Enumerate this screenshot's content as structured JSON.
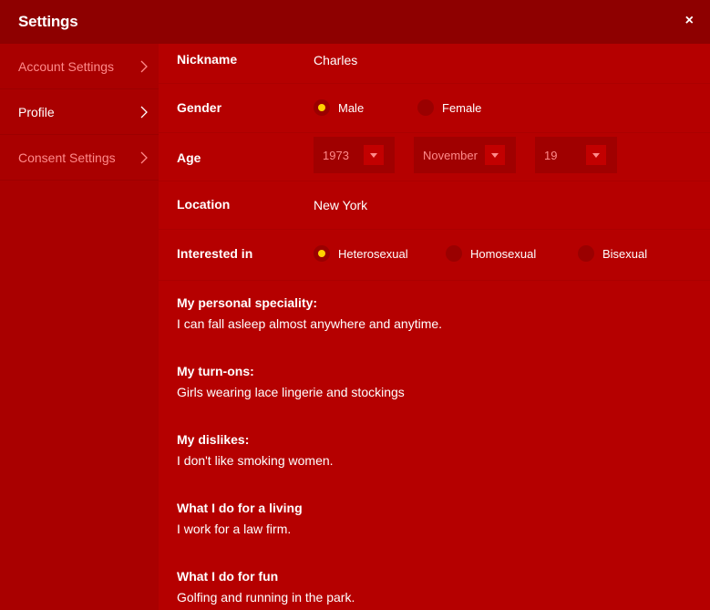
{
  "header": {
    "title": "Settings",
    "close": "×"
  },
  "sidebar": {
    "items": [
      {
        "label": "Account Settings"
      },
      {
        "label": "Profile"
      },
      {
        "label": "Consent Settings"
      }
    ]
  },
  "profile": {
    "nickname": {
      "label": "Nickname",
      "value": "Charles"
    },
    "gender": {
      "label": "Gender",
      "options": [
        "Male",
        "Female"
      ],
      "selected": "Male"
    },
    "age": {
      "label": "Age",
      "year": "1973",
      "month": "November",
      "day": "19"
    },
    "location": {
      "label": "Location",
      "value": "New York"
    },
    "interested_in": {
      "label": "Interested in",
      "options": [
        "Heterosexual",
        "Homosexual",
        "Bisexual"
      ],
      "selected": "Heterosexual"
    },
    "sections": [
      {
        "q": "My personal speciality:",
        "a": "I can fall asleep almost anywhere and anytime."
      },
      {
        "q": "My turn-ons:",
        "a": "Girls wearing lace lingerie and stockings"
      },
      {
        "q": "My dislikes:",
        "a": "I don't like smoking women."
      },
      {
        "q": "What I do for a living",
        "a": "I work for a law firm."
      },
      {
        "q": "What I do for fun",
        "a": "Golfing and running in the park."
      }
    ]
  },
  "colors": {
    "header": "#8e0000",
    "sidebar": "#a90000",
    "main": "#b50000",
    "radio_selected": "#ffd200",
    "muted_text": "#ff8a8a"
  }
}
